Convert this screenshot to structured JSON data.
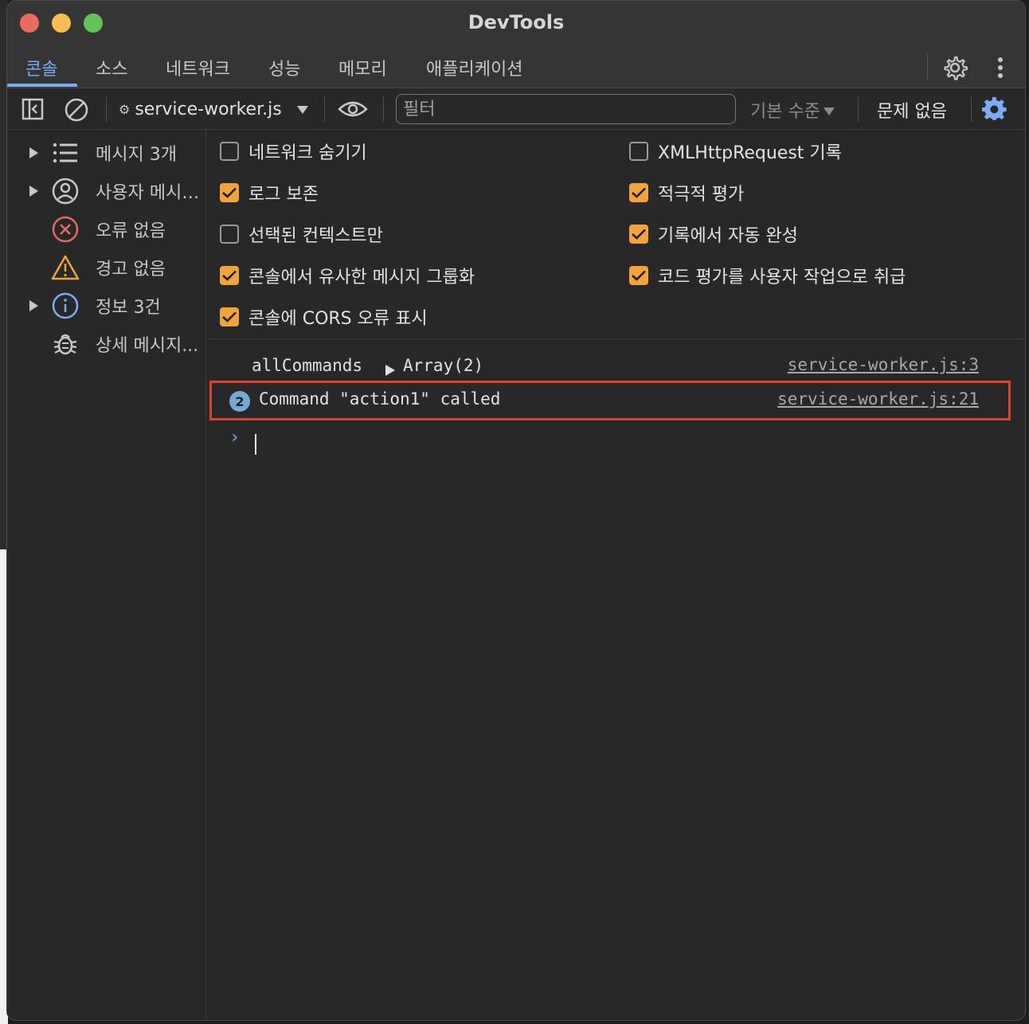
{
  "window": {
    "title": "DevTools"
  },
  "tabs": [
    {
      "label": "콘솔",
      "active": true
    },
    {
      "label": "소스"
    },
    {
      "label": "네트워크"
    },
    {
      "label": "성능"
    },
    {
      "label": "메모리"
    },
    {
      "label": "애플리케이션"
    }
  ],
  "toolbar": {
    "context": "service-worker.js",
    "filter_placeholder": "필터",
    "levels": "기본 수준",
    "issues": "문제 없음"
  },
  "sidebar": {
    "items": [
      {
        "label": "메시지 3개",
        "icon": "list-icon",
        "expandable": true
      },
      {
        "label": "사용자 메시지...",
        "icon": "user-icon",
        "expandable": true
      },
      {
        "label": "오류 없음",
        "icon": "error-icon",
        "expandable": false
      },
      {
        "label": "경고 없음",
        "icon": "warning-icon",
        "expandable": false
      },
      {
        "label": "정보 3건",
        "icon": "info-icon",
        "expandable": true
      },
      {
        "label": "상세 메시지...",
        "icon": "bug-icon",
        "expandable": false
      }
    ]
  },
  "settings": {
    "left": [
      {
        "label": "네트워크 숨기기",
        "checked": false
      },
      {
        "label": "로그 보존",
        "checked": true
      },
      {
        "label": "선택된 컨텍스트만",
        "checked": false
      },
      {
        "label": "콘솔에서 유사한 메시지 그룹화",
        "checked": true
      },
      {
        "label": "콘솔에 CORS 오류 표시",
        "checked": true
      }
    ],
    "right": [
      {
        "label": "XMLHttpRequest 기록",
        "checked": false
      },
      {
        "label": "적극적 평가",
        "checked": true
      },
      {
        "label": "기록에서 자동 완성",
        "checked": true
      },
      {
        "label": "코드 평가를 사용자 작업으로 취급",
        "checked": true
      }
    ]
  },
  "console": {
    "rows": [
      {
        "name": "allCommands",
        "value": "Array(2)",
        "source": "service-worker.js:3"
      },
      {
        "count": "2",
        "message": "Command \"action1\" called",
        "source": "service-worker.js:21"
      }
    ],
    "prompt": "›"
  },
  "colors": {
    "accent": "#7cacf8",
    "checkbox": "#f2a33a",
    "highlight": "#e0412f"
  }
}
